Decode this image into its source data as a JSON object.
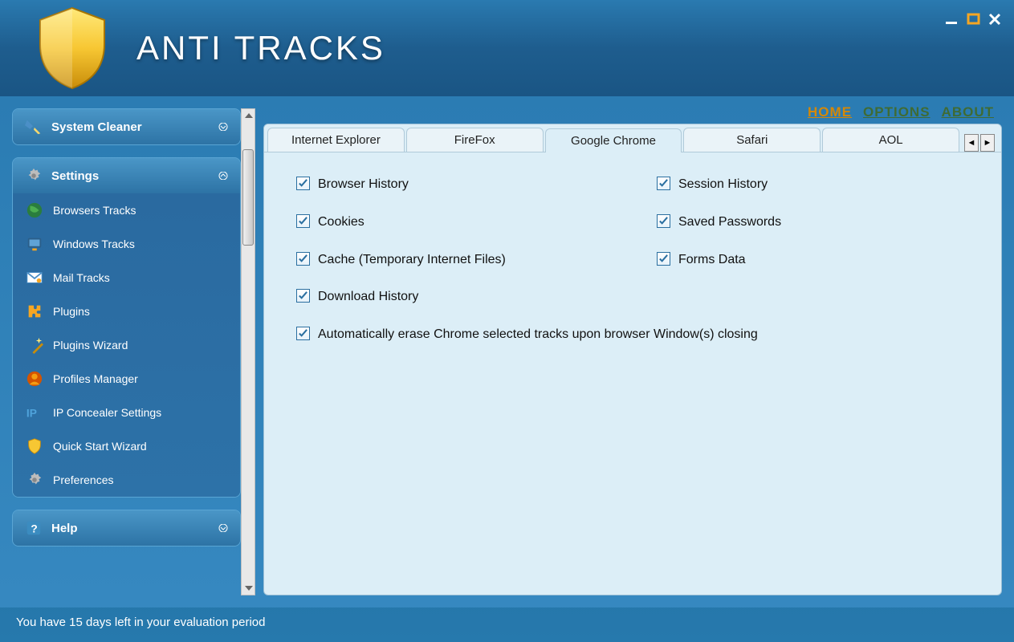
{
  "app": {
    "title": "ANTI TRACKS"
  },
  "top_links": [
    {
      "label": "HOME",
      "active": true
    },
    {
      "label": "OPTIONS",
      "active": false
    },
    {
      "label": "ABOUT",
      "active": false
    }
  ],
  "sidebar": {
    "panels": [
      {
        "id": "system-cleaner",
        "title": "System Cleaner",
        "icon": "broom-icon",
        "expanded": false,
        "items": []
      },
      {
        "id": "settings",
        "title": "Settings",
        "icon": "gear-icon",
        "expanded": true,
        "items": [
          {
            "label": "Browsers Tracks",
            "icon": "globe-icon"
          },
          {
            "label": "Windows Tracks",
            "icon": "monitor-icon"
          },
          {
            "label": "Mail Tracks",
            "icon": "envelope-icon"
          },
          {
            "label": "Plugins",
            "icon": "puzzle-icon"
          },
          {
            "label": "Plugins Wizard",
            "icon": "wand-icon"
          },
          {
            "label": "Profiles Manager",
            "icon": "profile-icon"
          },
          {
            "label": "IP Concealer Settings",
            "icon": "ip-icon"
          },
          {
            "label": "Quick Start Wizard",
            "icon": "shield-small-icon"
          },
          {
            "label": "Preferences",
            "icon": "gear-icon"
          }
        ]
      },
      {
        "id": "help",
        "title": "Help",
        "icon": "help-icon",
        "expanded": false,
        "items": []
      }
    ]
  },
  "tabs": [
    {
      "label": "Internet Explorer",
      "active": false
    },
    {
      "label": "FireFox",
      "active": false
    },
    {
      "label": "Google Chrome",
      "active": true
    },
    {
      "label": "Safari",
      "active": false
    },
    {
      "label": "AOL",
      "active": false
    }
  ],
  "checks": {
    "left": [
      {
        "label": "Browser History",
        "checked": true
      },
      {
        "label": "Cookies",
        "checked": true
      },
      {
        "label": "Cache (Temporary Internet Files)",
        "checked": true
      },
      {
        "label": "Download History",
        "checked": true
      }
    ],
    "right": [
      {
        "label": "Session History",
        "checked": true
      },
      {
        "label": "Saved Passwords",
        "checked": true
      },
      {
        "label": "Forms Data",
        "checked": true
      }
    ],
    "full": {
      "label": "Automatically erase Chrome selected tracks upon browser Window(s) closing",
      "checked": true
    }
  },
  "status": "You have 15 days left in your evaluation period"
}
